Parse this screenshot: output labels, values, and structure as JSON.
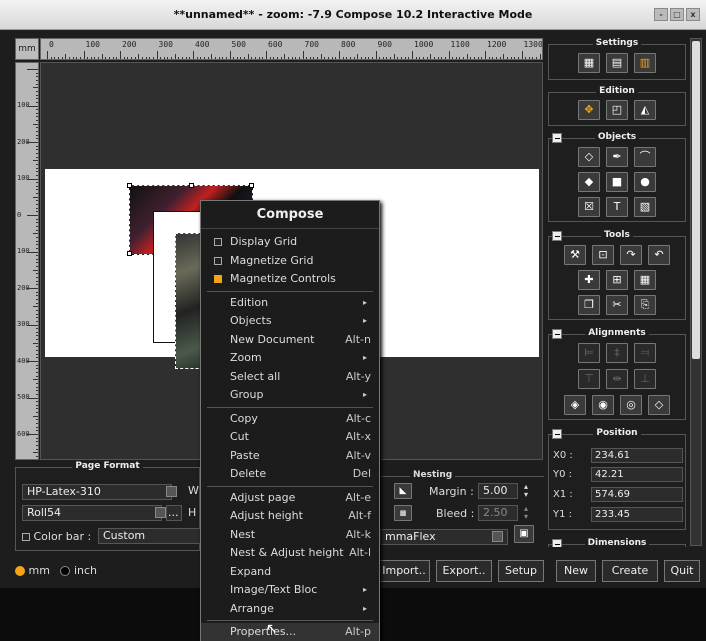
{
  "window": {
    "title": "**unnamed** - zoom: -7.9 Compose 10.2 Interactive Mode",
    "buttons": [
      "-",
      "□",
      "x"
    ]
  },
  "ruler": {
    "unit": "mm",
    "h_labels": [
      "0",
      "100",
      "200",
      "300",
      "400",
      "500",
      "600",
      "700",
      "800",
      "900",
      "1000",
      "1100",
      "1200",
      "1300"
    ],
    "v_labels": [
      "100",
      "200",
      "100",
      "0",
      "100",
      "200",
      "300",
      "400",
      "500",
      "600",
      "700"
    ]
  },
  "panels": {
    "settings": "Settings",
    "edition": "Edition",
    "objects": "Objects",
    "tools": "Tools",
    "alignments": "Alignments",
    "position": "Position",
    "dimensions": "Dimensions"
  },
  "position": {
    "x0_label": "X0 :",
    "x0": "234.61",
    "y0_label": "Y0 :",
    "y0": "42.21",
    "x1_label": "X1 :",
    "x1": "574.69",
    "y1_label": "Y1 :",
    "y1": "233.45"
  },
  "page_format": {
    "title": "Page Format",
    "printer": "HP-Latex-310",
    "media": "Roll54",
    "media_btn": "...",
    "w_label": "W",
    "h_label": "H",
    "color_bar_label": "Color bar :",
    "color_bar_value": "Custom"
  },
  "nesting": {
    "title": "Nesting",
    "margin_label": "Margin :",
    "margin_value": "5.00",
    "bleed_label": "Bleed :",
    "bleed_value": "2.50",
    "profile": "mmaFlex"
  },
  "units": {
    "mm": "mm",
    "inch": "inch"
  },
  "bottom_buttons": {
    "import": "Import..",
    "export": "Export..",
    "setup": "Setup",
    "new": "New",
    "create": "Create",
    "quit": "Quit"
  },
  "menu": {
    "title": "Compose",
    "check_items": [
      {
        "label": "Display Grid",
        "checked": false
      },
      {
        "label": "Magnetize Grid",
        "checked": false
      },
      {
        "label": "Magnetize Controls",
        "checked": true
      }
    ],
    "group1": [
      {
        "label": "Edition",
        "shortcut": "▸"
      },
      {
        "label": "Objects",
        "shortcut": "▸"
      },
      {
        "label": "New Document",
        "shortcut": "Alt-n"
      },
      {
        "label": "Zoom",
        "shortcut": "▸"
      },
      {
        "label": "Select all",
        "shortcut": "Alt-y"
      },
      {
        "label": "Group",
        "shortcut": "▸"
      }
    ],
    "group2": [
      {
        "label": "Copy",
        "shortcut": "Alt-c"
      },
      {
        "label": "Cut",
        "shortcut": "Alt-x"
      },
      {
        "label": "Paste",
        "shortcut": "Alt-v"
      },
      {
        "label": "Delete",
        "shortcut": "Del"
      }
    ],
    "group3": [
      {
        "label": "Adjust page",
        "shortcut": "Alt-e"
      },
      {
        "label": "Adjust height",
        "shortcut": "Alt-f"
      },
      {
        "label": "Nest",
        "shortcut": "Alt-k"
      },
      {
        "label": "Nest & Adjust height",
        "shortcut": "Alt-l"
      },
      {
        "label": "Expand",
        "shortcut": ""
      },
      {
        "label": "Image/Text Bloc",
        "shortcut": "▸"
      },
      {
        "label": "Arrange",
        "shortcut": "▸"
      }
    ],
    "group4": [
      {
        "label": "Properties...",
        "shortcut": "Alt-p"
      }
    ]
  },
  "colors": {
    "accent": "#f4a31b",
    "bg": "#1d1d1d"
  }
}
